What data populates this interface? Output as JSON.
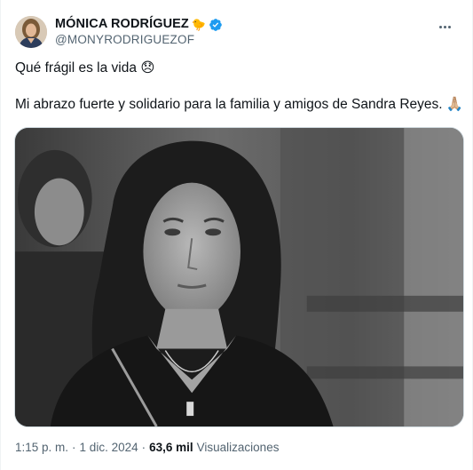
{
  "author": {
    "display_name": "MÓNICA RODRÍGUEZ",
    "name_emoji": "🐤",
    "handle": "@MONYRODRIGUEZOF",
    "verified_color": "#1d9bf0"
  },
  "tweet": {
    "line1": "Qué frágil es la vida 😞",
    "line2": "Mi abrazo fuerte y solidario para la familia y amigos de Sandra Reyes. 🙏🏼"
  },
  "meta": {
    "time": "1:15 p. m.",
    "separator": "·",
    "date": "1 dic. 2024",
    "views_count": "63,6 mil",
    "views_label": "Visualizaciones"
  },
  "icons": {
    "more": "more-dots-icon",
    "verified": "verified-badge-icon"
  }
}
